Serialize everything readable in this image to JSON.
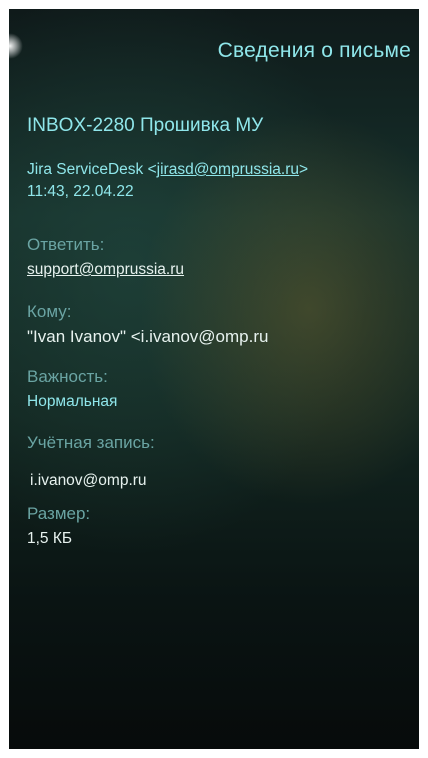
{
  "header": {
    "title": "Сведения о письме"
  },
  "message": {
    "subject": "INBOX-2280 Прошивка МУ",
    "sender_name": "Jira ServiceDesk ",
    "sender_open": "<",
    "sender_email": "jirasd@omprussia.ru",
    "sender_close": ">",
    "date": "11:43, 22.04.22"
  },
  "details": {
    "reply_label": "Ответить:",
    "reply_value": "support@omprussia.ru",
    "to_label": "Кому:",
    "to_value": "\"Ivan Ivanov\" <i.ivanov@omp.ru",
    "importance_label": "Важность:",
    "importance_value": "Нормальная",
    "account_label": "Учётная запись:",
    "account_value": "i.ivanov@omp.ru",
    "size_label": "Размер:",
    "size_value": "1,5 КБ"
  },
  "colors": {
    "accent": "#8fe6ea",
    "label": "#6aa4a3",
    "text": "#e7f2ef"
  }
}
